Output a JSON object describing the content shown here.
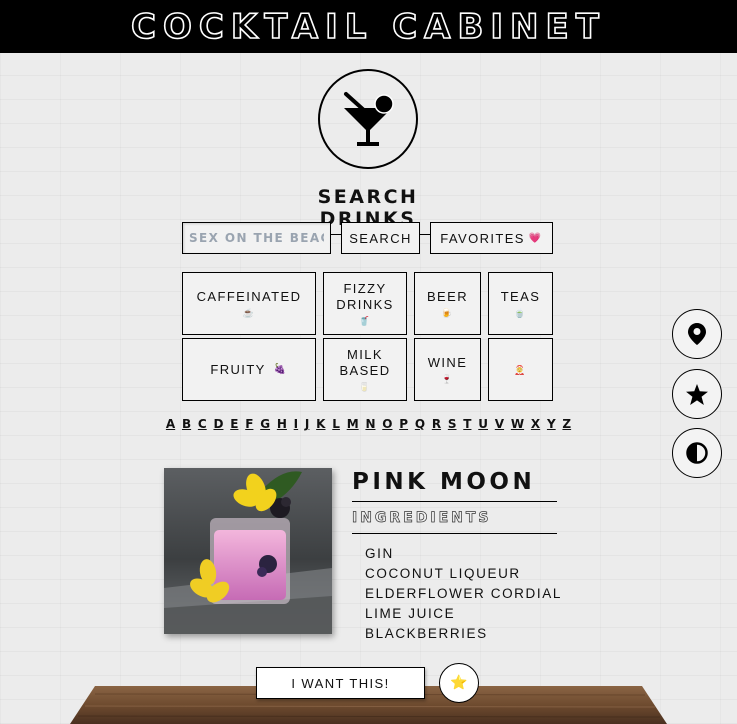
{
  "header": {
    "title": "COCKTAIL CABINET"
  },
  "logo": {
    "icon": "martini-glass-icon"
  },
  "search": {
    "title": "SEARCH DRINKS",
    "placeholder": "SEX ON THE BEACH",
    "button_label": "SEARCH",
    "favorites_label": "FAVORITES",
    "favorites_emoji": "💗"
  },
  "categories": [
    {
      "label": "CAFFEINATED",
      "emoji": "☕"
    },
    {
      "label": "FIZZY DRINKS",
      "emoji": "🥤"
    },
    {
      "label": "BEER",
      "emoji": "🍺"
    },
    {
      "label": "TEAS",
      "emoji": "🍵"
    },
    {
      "label": "FRUITY",
      "emoji": "🍇"
    },
    {
      "label": "MILK BASED",
      "emoji": "🥛"
    },
    {
      "label": "WINE",
      "emoji": "🍷"
    },
    {
      "label": "",
      "emoji": "🤶"
    }
  ],
  "alphabet": [
    "A",
    "B",
    "C",
    "D",
    "E",
    "F",
    "G",
    "H",
    "I",
    "J",
    "K",
    "L",
    "M",
    "N",
    "O",
    "P",
    "Q",
    "R",
    "S",
    "T",
    "U",
    "V",
    "W",
    "X",
    "Y",
    "Z"
  ],
  "drink": {
    "name": "PINK MOON",
    "ingredients_title": "INGREDIENTS",
    "ingredients": [
      "GIN",
      "COCONUT LIQUEUR",
      "ELDERFLOWER CORDIAL",
      "LIME JUICE",
      "BLACKBERRIES"
    ],
    "image": "pink-cocktail-photo"
  },
  "actions": {
    "want_label": "I WANT THIS!",
    "star_emoji": "⭐"
  },
  "side_buttons": [
    {
      "icon": "location-pin-icon"
    },
    {
      "icon": "star-icon"
    },
    {
      "icon": "contrast-icon"
    }
  ]
}
